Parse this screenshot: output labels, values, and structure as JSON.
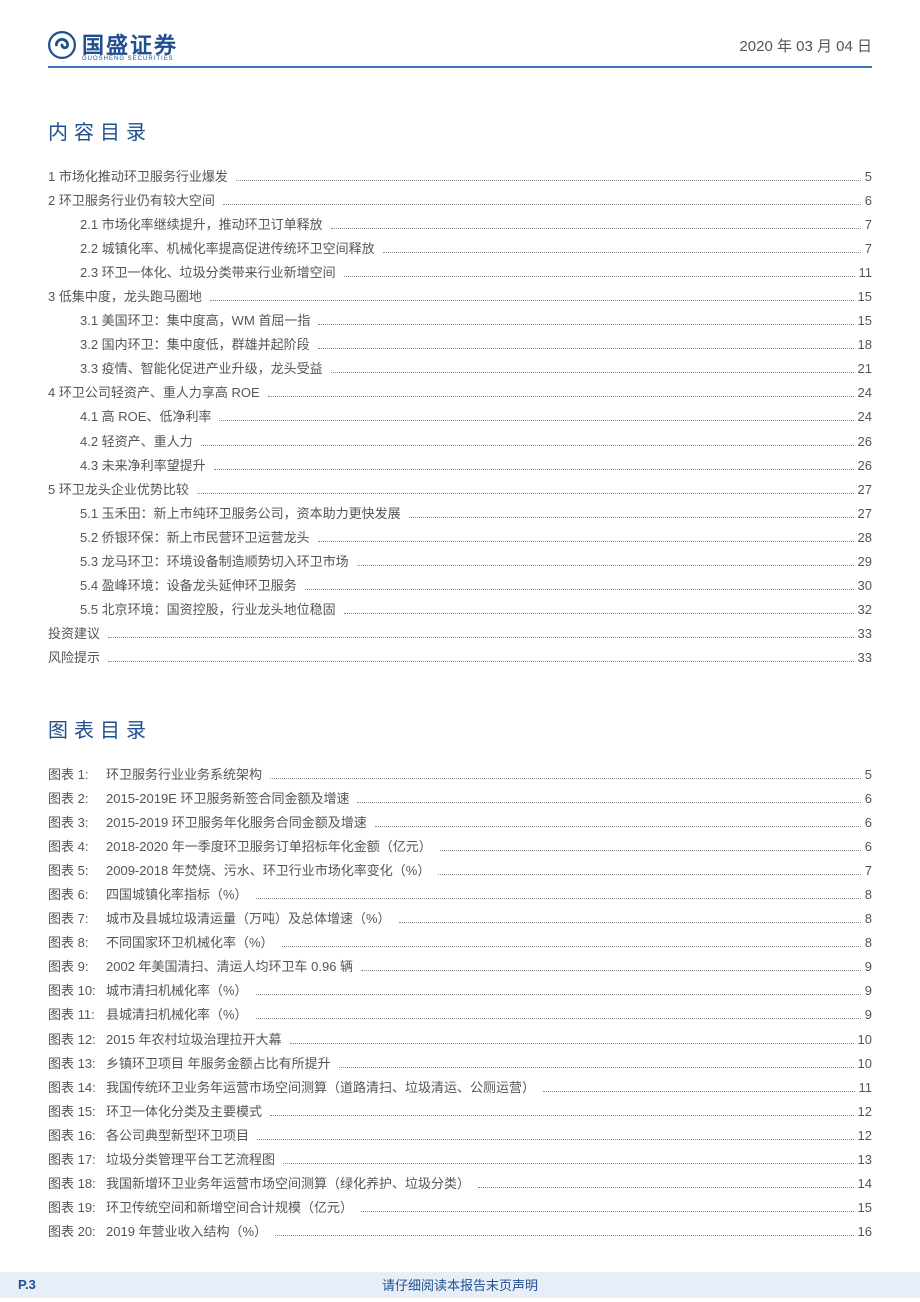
{
  "header": {
    "brand": "国盛证券",
    "brand_sub": "GUOSHENG SECURITIES",
    "date": "2020 年 03 月 04 日"
  },
  "toc_title": "内容目录",
  "toc": [
    {
      "level": 0,
      "text": "1 市场化推动环卫服务行业爆发",
      "page": "5"
    },
    {
      "level": 0,
      "text": "2 环卫服务行业仍有较大空间",
      "page": "6"
    },
    {
      "level": 1,
      "text": "2.1 市场化率继续提升，推动环卫订单释放",
      "page": "7"
    },
    {
      "level": 1,
      "text": "2.2 城镇化率、机械化率提高促进传统环卫空间释放",
      "page": "7"
    },
    {
      "level": 1,
      "text": "2.3 环卫一体化、垃圾分类带来行业新增空间",
      "page": "11"
    },
    {
      "level": 0,
      "text": "3 低集中度，龙头跑马圈地",
      "page": "15"
    },
    {
      "level": 1,
      "text": "3.1 美国环卫：集中度高，WM 首屈一指",
      "page": "15"
    },
    {
      "level": 1,
      "text": "3.2 国内环卫：集中度低，群雄并起阶段",
      "page": "18"
    },
    {
      "level": 1,
      "text": "3.3 疫情、智能化促进产业升级，龙头受益",
      "page": "21"
    },
    {
      "level": 0,
      "text": "4 环卫公司轻资产、重人力享高 ROE",
      "page": "24"
    },
    {
      "level": 1,
      "text": "4.1 高 ROE、低净利率",
      "page": "24"
    },
    {
      "level": 1,
      "text": "4.2 轻资产、重人力",
      "page": "26"
    },
    {
      "level": 1,
      "text": "4.3 未来净利率望提升",
      "page": "26"
    },
    {
      "level": 0,
      "text": "5 环卫龙头企业优势比较",
      "page": "27"
    },
    {
      "level": 1,
      "text": "5.1 玉禾田：新上市纯环卫服务公司，资本助力更快发展",
      "page": "27"
    },
    {
      "level": 1,
      "text": "5.2 侨银环保：新上市民营环卫运营龙头",
      "page": "28"
    },
    {
      "level": 1,
      "text": "5.3 龙马环卫：环境设备制造顺势切入环卫市场",
      "page": "29"
    },
    {
      "level": 1,
      "text": "5.4 盈峰环境：设备龙头延伸环卫服务",
      "page": "30"
    },
    {
      "level": 1,
      "text": "5.5 北京环境：国资控股，行业龙头地位稳固",
      "page": "32"
    },
    {
      "level": 0,
      "text": "投资建议",
      "page": "33"
    },
    {
      "level": 0,
      "text": "风险提示",
      "page": "33"
    }
  ],
  "figures_title": "图表目录",
  "figures": [
    {
      "num": "图表 1:",
      "text": "环卫服务行业业务系统架构",
      "page": "5"
    },
    {
      "num": "图表 2:",
      "text": "2015-2019E 环卫服务新签合同金额及增速",
      "page": "6"
    },
    {
      "num": "图表 3:",
      "text": "2015-2019 环卫服务年化服务合同金额及增速",
      "page": "6"
    },
    {
      "num": "图表 4:",
      "text": "2018-2020 年一季度环卫服务订单招标年化金额（亿元）",
      "page": "6"
    },
    {
      "num": "图表 5:",
      "text": "2009-2018 年焚烧、污水、环卫行业市场化率变化（%）",
      "page": "7"
    },
    {
      "num": "图表 6:",
      "text": "四国城镇化率指标（%）",
      "page": "8"
    },
    {
      "num": "图表 7:",
      "text": "城市及县城垃圾清运量（万吨）及总体增速（%）",
      "page": "8"
    },
    {
      "num": "图表 8:",
      "text": "不同国家环卫机械化率（%）",
      "page": "8"
    },
    {
      "num": "图表 9:",
      "text": "2002 年美国清扫、清运人均环卫车 0.96 辆",
      "page": "9"
    },
    {
      "num": "图表 10:",
      "text": "城市清扫机械化率（%）",
      "page": "9"
    },
    {
      "num": "图表 11:",
      "text": "县城清扫机械化率（%）",
      "page": "9"
    },
    {
      "num": "图表 12:",
      "text": "2015 年农村垃圾治理拉开大幕",
      "page": "10"
    },
    {
      "num": "图表 13:",
      "text": "乡镇环卫项目 年服务金额占比有所提升",
      "page": "10"
    },
    {
      "num": "图表 14:",
      "text": "我国传统环卫业务年运营市场空间测算（道路清扫、垃圾清运、公厕运营）",
      "page": "11"
    },
    {
      "num": "图表 15:",
      "text": "环卫一体化分类及主要模式",
      "page": "12"
    },
    {
      "num": "图表 16:",
      "text": "各公司典型新型环卫项目",
      "page": "12"
    },
    {
      "num": "图表 17:",
      "text": "垃圾分类管理平台工艺流程图",
      "page": "13"
    },
    {
      "num": "图表 18:",
      "text": "我国新增环卫业务年运营市场空间测算（绿化养护、垃圾分类）",
      "page": "14"
    },
    {
      "num": "图表 19:",
      "text": "环卫传统空间和新增空间合计规模（亿元）",
      "page": "15"
    },
    {
      "num": "图表 20:",
      "text": "2019 年营业收入结构（%）",
      "page": "16"
    }
  ],
  "footer": {
    "page_label": "P.3",
    "disclaimer": "请仔细阅读本报告末页声明"
  }
}
